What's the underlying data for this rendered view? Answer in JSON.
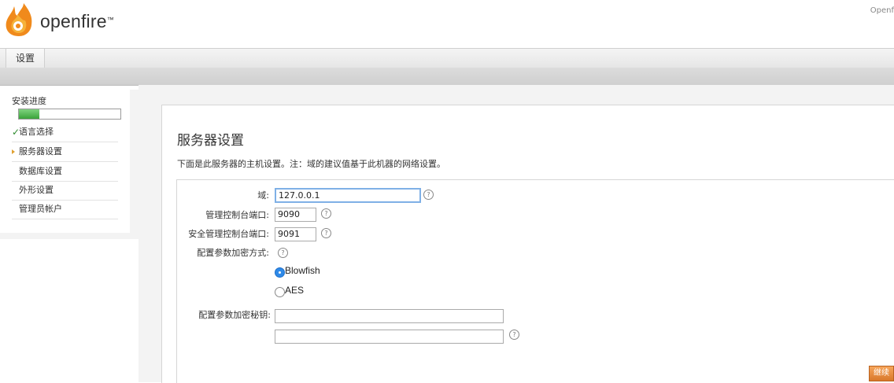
{
  "header": {
    "brand": "openfire",
    "brand_tm": "™",
    "version_text": "Openf"
  },
  "nav": {
    "tab_label": "设置"
  },
  "sidebar": {
    "title": "安装进度",
    "progress_percent": 20,
    "items": [
      {
        "label": "语言选择",
        "state": "done"
      },
      {
        "label": "服务器设置",
        "state": "current"
      },
      {
        "label": "数据库设置",
        "state": "pending"
      },
      {
        "label": "外形设置",
        "state": "pending"
      },
      {
        "label": "管理员帐户",
        "state": "pending"
      }
    ]
  },
  "main": {
    "title": "服务器设置",
    "description": "下面是此服务器的主机设置。注：域的建议值基于此机器的网络设置。",
    "fields": {
      "domain": {
        "label": "域:",
        "value": "127.0.0.1"
      },
      "admin_port": {
        "label": "管理控制台端口:",
        "value": "9090"
      },
      "secure_admin_port": {
        "label": "安全管理控制台端口:",
        "value": "9091"
      },
      "encryption_method": {
        "label": "配置参数加密方式:",
        "options": [
          "Blowfish",
          "AES"
        ],
        "selected": "Blowfish"
      },
      "encryption_key": {
        "label": "配置参数加密秘钥:",
        "value": "",
        "confirm_value": ""
      }
    },
    "help_glyph": "?",
    "continue_label": "继续"
  },
  "colors": {
    "accent_green": "#3aa33a",
    "button_orange": "#e08a3a",
    "focus_blue": "#7fb0e6"
  }
}
